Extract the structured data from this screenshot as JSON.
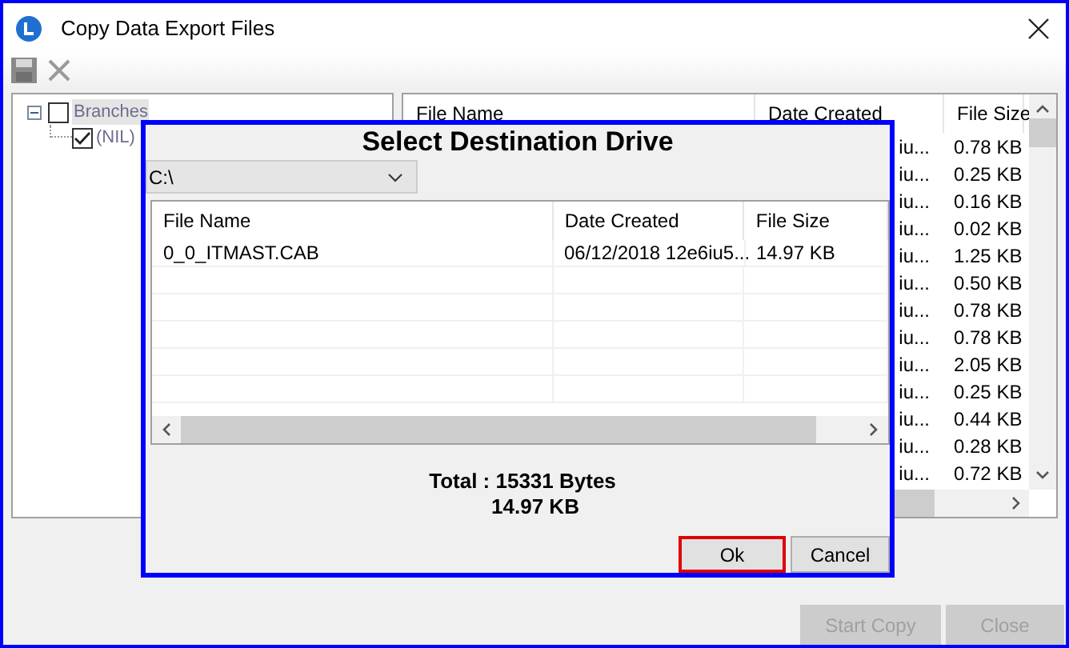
{
  "window": {
    "title": "Copy Data Export Files"
  },
  "tree": [
    {
      "label": "Branches",
      "checked": false,
      "expanded": true,
      "selected": true,
      "children": [
        {
          "label": "(NIL)",
          "checked": true,
          "selected": false
        }
      ]
    }
  ],
  "file_list": {
    "columns": [
      "File Name",
      "Date Created",
      "File Size"
    ],
    "rows": [
      {
        "date": "iu...",
        "size": "0.78 KB"
      },
      {
        "date": "iu...",
        "size": "0.25 KB"
      },
      {
        "date": "iu...",
        "size": "0.16 KB"
      },
      {
        "date": "iu...",
        "size": "0.02 KB"
      },
      {
        "date": "iu...",
        "size": "1.25 KB"
      },
      {
        "date": "iu...",
        "size": "0.50 KB"
      },
      {
        "date": "iu...",
        "size": "0.78 KB"
      },
      {
        "date": "iu...",
        "size": "0.78 KB"
      },
      {
        "date": "iu...",
        "size": "2.05 KB"
      },
      {
        "date": "iu...",
        "size": "0.25 KB"
      },
      {
        "date": "iu...",
        "size": "0.44 KB"
      },
      {
        "date": "iu...",
        "size": "0.28 KB"
      },
      {
        "date": "iu...",
        "size": "0.72 KB"
      }
    ]
  },
  "buttons": [
    {
      "label": "Start Copy",
      "disabled": true
    },
    {
      "label": "Close",
      "disabled": true
    }
  ],
  "dialog": {
    "title": "Select Destination Drive",
    "drive": "C:\\",
    "columns": [
      "File Name",
      "Date Created",
      "File Size"
    ],
    "rows": [
      {
        "name": "0_0_ITMAST.CAB",
        "date": "06/12/2018 12e6iu5...",
        "size": "14.97 KB"
      }
    ],
    "total_bytes": "Total : 15331 Bytes",
    "total_kb": "14.97 KB",
    "buttons": [
      {
        "label": "Ok",
        "focused": true
      },
      {
        "label": "Cancel",
        "focused": false
      }
    ]
  }
}
